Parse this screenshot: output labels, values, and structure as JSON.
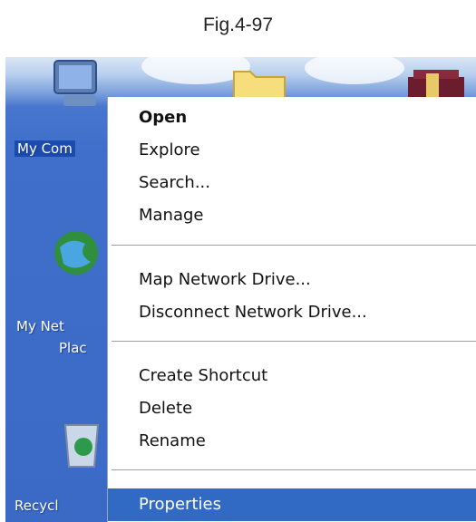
{
  "caption": "Fig.4-97",
  "desktop": {
    "icons": [
      {
        "name": "My Computer",
        "label": "My Com"
      },
      {
        "name": "My Network Places",
        "label_line1": "My Net",
        "label_line2": "Plac"
      },
      {
        "name": "Recycle Bin",
        "label": "Recycl"
      }
    ]
  },
  "context_menu": {
    "items": [
      {
        "label": "Open",
        "bold": true
      },
      {
        "label": "Explore"
      },
      {
        "label": "Search..."
      },
      {
        "label": "Manage"
      },
      {
        "label": "Map Network Drive..."
      },
      {
        "label": "Disconnect Network Drive..."
      },
      {
        "label": "Create Shortcut"
      },
      {
        "label": "Delete"
      },
      {
        "label": "Rename"
      },
      {
        "label": "Properties",
        "highlighted": true
      }
    ]
  },
  "colors": {
    "desktop_blue": "#3b69c6",
    "highlight": "#316ac5",
    "menu_bg": "#ffffff"
  }
}
